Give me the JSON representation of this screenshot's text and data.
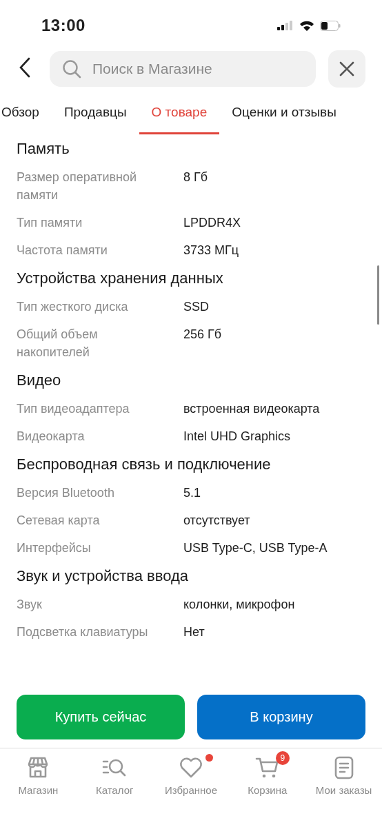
{
  "status_bar": {
    "time": "13:00"
  },
  "search": {
    "placeholder": "Поиск в Магазине"
  },
  "tabs": [
    {
      "label": "Обзор",
      "selected": false
    },
    {
      "label": "Продавцы",
      "selected": false
    },
    {
      "label": "О товаре",
      "selected": true
    },
    {
      "label": "Оценки и отзывы",
      "selected": false
    }
  ],
  "sections": [
    {
      "title": "Память",
      "rows": [
        {
          "label": "Размер оперативной памяти",
          "value": "8 Гб"
        },
        {
          "label": "Тип памяти",
          "value": "LPDDR4X"
        },
        {
          "label": "Частота памяти",
          "value": "3733 МГц"
        }
      ]
    },
    {
      "title": "Устройства хранения данных",
      "rows": [
        {
          "label": "Тип жесткого диска",
          "value": "SSD"
        },
        {
          "label": "Общий объем накопителей",
          "value": "256 Гб"
        }
      ]
    },
    {
      "title": "Видео",
      "rows": [
        {
          "label": "Тип видеоадаптера",
          "value": "встроенная видеокарта"
        },
        {
          "label": "Видеокарта",
          "value": "Intel UHD Graphics"
        }
      ]
    },
    {
      "title": "Беспроводная связь и подключение",
      "rows": [
        {
          "label": "Версия Bluetooth",
          "value": "5.1"
        },
        {
          "label": "Сетевая карта",
          "value": "отсутствует"
        },
        {
          "label": "Интерфейсы",
          "value": "USB Type-C, USB Type-A"
        }
      ]
    },
    {
      "title": "Звук и устройства ввода",
      "rows": [
        {
          "label": "Звук",
          "value": "колонки, микрофон"
        },
        {
          "label": "Подсветка клавиатуры",
          "value": "Нет"
        }
      ]
    }
  ],
  "actions": [
    {
      "label": "Купить сейчас",
      "kind": "buy"
    },
    {
      "label": "В корзину",
      "kind": "cart"
    }
  ],
  "nav": [
    {
      "label": "Магазин",
      "kind": "store",
      "dot": false
    },
    {
      "label": "Каталог",
      "kind": "catalog",
      "dot": false
    },
    {
      "label": "Избранное",
      "kind": "favorites",
      "dot": true
    },
    {
      "label": "Корзина",
      "kind": "cart",
      "dot": false,
      "badge": "9"
    },
    {
      "label": "Мои заказы",
      "kind": "orders",
      "dot": false
    }
  ]
}
